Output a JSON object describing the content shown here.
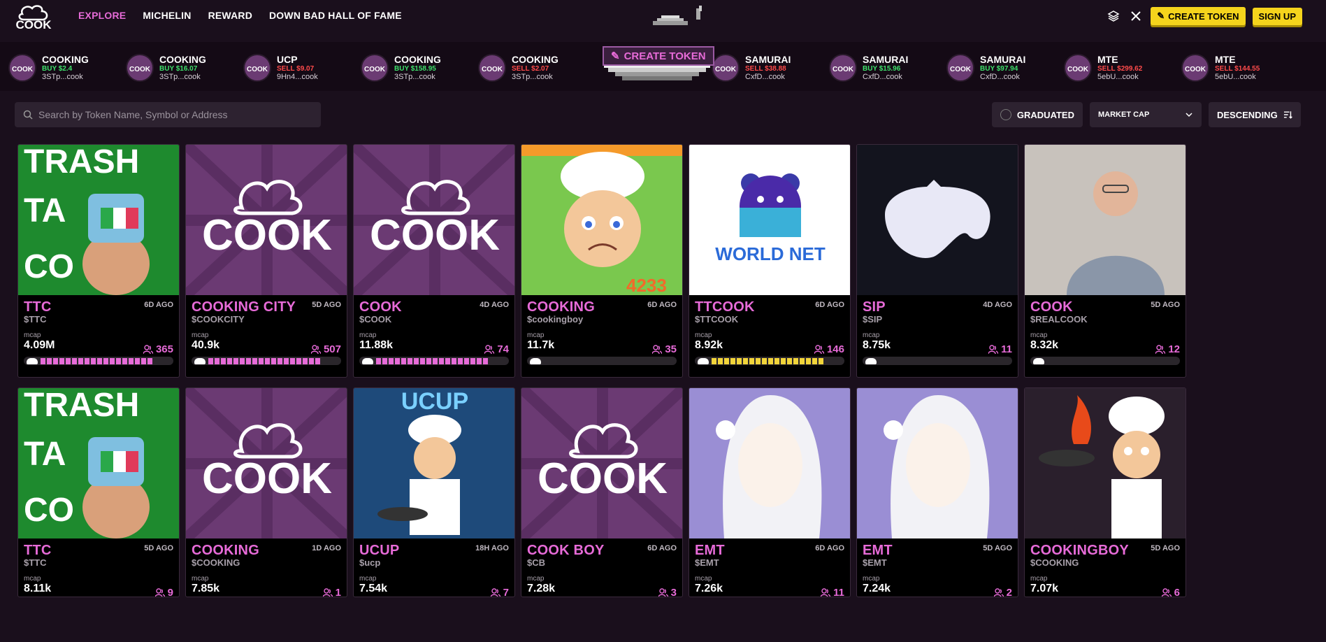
{
  "nav": {
    "items": [
      "EXPLORE",
      "MICHELIN",
      "REWARD",
      "DOWN BAD HALL OF FAME"
    ],
    "active": "EXPLORE"
  },
  "header": {
    "create_token": "CREATE TOKEN",
    "sign_up": "SIGN UP",
    "logo_text": "COOK"
  },
  "ticker": [
    {
      "name": "COOKING",
      "trade": "BUY $2.4",
      "side": "buy",
      "addr": "3STp...cook"
    },
    {
      "name": "COOKING",
      "trade": "BUY $16.07",
      "side": "buy",
      "addr": "3STp...cook"
    },
    {
      "name": "UCP",
      "trade": "SELL $9.07",
      "side": "sell",
      "addr": "9Hn4...cook"
    },
    {
      "name": "COOKING",
      "trade": "BUY $158.95",
      "side": "buy",
      "addr": "3STp...cook"
    },
    {
      "name": "COOKING",
      "trade": "SELL $2.07",
      "side": "sell",
      "addr": "3STp...cook"
    },
    {
      "name": "SAMURAI",
      "trade": "SELL $38.88",
      "side": "sell",
      "addr": "CxfD...cook"
    },
    {
      "name": "SAMURAI",
      "trade": "BUY $15.96",
      "side": "buy",
      "addr": "CxfD...cook"
    },
    {
      "name": "SAMURAI",
      "trade": "BUY $97.94",
      "side": "buy",
      "addr": "CxfD...cook"
    },
    {
      "name": "MTE",
      "trade": "SELL $299.62",
      "side": "sell",
      "addr": "5ebU...cook"
    },
    {
      "name": "MTE",
      "trade": "SELL $144.55",
      "side": "sell",
      "addr": "5ebU...cook"
    }
  ],
  "center_create": "CREATE TOKEN",
  "search": {
    "placeholder": "Search by Token Name, Symbol or Address"
  },
  "filters": {
    "graduated": "GRADUATED",
    "sort_by": "MARKET CAP",
    "order": "DESCENDING"
  },
  "cards": [
    {
      "name": "TTC",
      "symbol": "$TTC",
      "age": "6D AGO",
      "mcap_label": "mcap",
      "mcap": "4.09M",
      "holders": "365",
      "progress": 0.9,
      "bar": "pink",
      "img": "ttc"
    },
    {
      "name": "COOKING CITY",
      "symbol": "$COOKCITY",
      "age": "5D AGO",
      "mcap_label": "mcap",
      "mcap": "40.9k",
      "holders": "507",
      "progress": 0.9,
      "bar": "pink",
      "img": "cook"
    },
    {
      "name": "COOK",
      "symbol": "$COOK",
      "age": "4D AGO",
      "mcap_label": "mcap",
      "mcap": "11.88k",
      "holders": "74",
      "progress": 0.9,
      "bar": "pink",
      "img": "cook"
    },
    {
      "name": "COOKING",
      "symbol": "$cookingboy",
      "age": "6D AGO",
      "mcap_label": "mcap",
      "mcap": "11.7k",
      "holders": "35",
      "progress": 0.0,
      "bar": "pink",
      "img": "chef"
    },
    {
      "name": "TTCOOK",
      "symbol": "$TTCOOK",
      "age": "6D AGO",
      "mcap_label": "mcap",
      "mcap": "8.92k",
      "holders": "146",
      "progress": 0.9,
      "bar": "yellow",
      "img": "worldnet"
    },
    {
      "name": "SIP",
      "symbol": "$SIP",
      "age": "4D AGO",
      "mcap_label": "mcap",
      "mcap": "8.75k",
      "holders": "11",
      "progress": 0.0,
      "bar": "pink",
      "img": "sip"
    },
    {
      "name": "COOK",
      "symbol": "$REALCOOK",
      "age": "5D AGO",
      "mcap_label": "mcap",
      "mcap": "8.32k",
      "holders": "12",
      "progress": 0.0,
      "bar": "pink",
      "img": "person"
    },
    {
      "name": "TTC",
      "symbol": "$TTC",
      "age": "5D AGO",
      "mcap_label": "mcap",
      "mcap": "8.11k",
      "holders": "9",
      "progress": 0.0,
      "bar": "pink",
      "img": "ttc"
    },
    {
      "name": "COOKING",
      "symbol": "$COOKING",
      "age": "1D AGO",
      "mcap_label": "mcap",
      "mcap": "7.85k",
      "holders": "1",
      "progress": 0.0,
      "bar": "pink",
      "img": "cook"
    },
    {
      "name": "UCUP",
      "symbol": "$ucp",
      "age": "18H AGO",
      "mcap_label": "mcap",
      "mcap": "7.54k",
      "holders": "7",
      "progress": 0.0,
      "bar": "pink",
      "img": "ucup"
    },
    {
      "name": "COOK BOY",
      "symbol": "$CB",
      "age": "6D AGO",
      "mcap_label": "mcap",
      "mcap": "7.28k",
      "holders": "3",
      "progress": 0.0,
      "bar": "pink",
      "img": "cook"
    },
    {
      "name": "EMT",
      "symbol": "$EMT",
      "age": "6D AGO",
      "mcap_label": "mcap",
      "mcap": "7.26k",
      "holders": "11",
      "progress": 0.0,
      "bar": "pink",
      "img": "emt"
    },
    {
      "name": "EMT",
      "symbol": "$EMT",
      "age": "5D AGO",
      "mcap_label": "mcap",
      "mcap": "7.24k",
      "holders": "2",
      "progress": 0.0,
      "bar": "pink",
      "img": "emt"
    },
    {
      "name": "COOKINGBOY",
      "symbol": "$COOKING",
      "age": "5D AGO",
      "mcap_label": "mcap",
      "mcap": "7.07k",
      "holders": "6",
      "progress": 0.0,
      "bar": "pink",
      "img": "chefboy"
    }
  ],
  "colors": {
    "accent": "#e76bd8",
    "yellow": "#f5d41c",
    "bg": "#1a0f1c",
    "buy": "#3ee06b",
    "sell": "#ff4b4b"
  }
}
